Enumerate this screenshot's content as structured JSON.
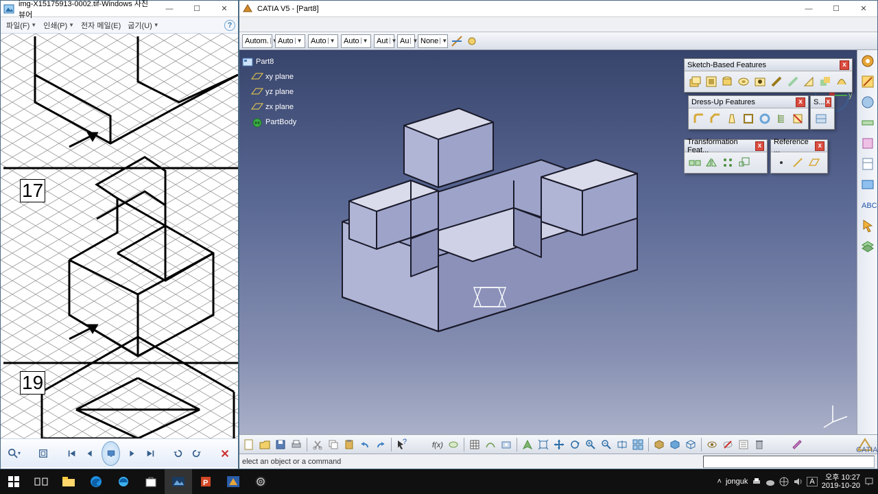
{
  "viewer": {
    "title": "img-X15175913-0002.tif-Windows 사진 뷰어",
    "menu": {
      "file": "파일(F)",
      "print": "인쇄(P)",
      "email": "전자 메일(E)",
      "write": "굽기(U)"
    },
    "figures": {
      "top_num": "",
      "mid_num": "17",
      "bot_num": "19"
    },
    "tb": {
      "zoom": "zoom",
      "fit": "fit",
      "first": "first",
      "prev": "prev",
      "play": "play",
      "next": "next",
      "last": "last",
      "rotl": "rotate-left",
      "rotr": "rotate-right",
      "del": "delete"
    }
  },
  "catia": {
    "title": "CATIA V5 - [Part8]",
    "options": [
      "Autom.",
      "Auto",
      "Auto",
      "Auto",
      "Aut",
      "Au",
      "None"
    ],
    "tree": {
      "root": "Part8",
      "xy": "xy plane",
      "yz": "yz plane",
      "zx": "zx plane",
      "body": "PartBody"
    },
    "ftb": {
      "sketch": "Sketch-Based Features",
      "dress": "Dress-Up Features",
      "trans": "Transformation Feat...",
      "ref": "Reference ...",
      "s": "S..."
    },
    "status": "elect an object or a command",
    "logo": "CATIA"
  },
  "taskbar": {
    "user": "jonguk",
    "ime": "A",
    "time": "오후 10:27",
    "date": "2019-10-20"
  }
}
